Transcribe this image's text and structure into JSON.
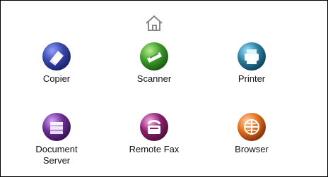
{
  "home": {
    "icon": "home-icon"
  },
  "apps": [
    {
      "label": "Copier",
      "icon": "copier-icon",
      "color": "#2f3f9c"
    },
    {
      "label": "Scanner",
      "icon": "scanner-icon",
      "color": "#3e9a2c"
    },
    {
      "label": "Printer",
      "icon": "printer-icon",
      "color": "#1f6f8c"
    },
    {
      "label": "Document Server",
      "icon": "document-server-icon",
      "color": "#6a2c8f"
    },
    {
      "label": "Remote Fax",
      "icon": "remote-fax-icon",
      "color": "#8a1f6f"
    },
    {
      "label": "Browser",
      "icon": "browser-icon",
      "color": "#e36f1e"
    }
  ]
}
